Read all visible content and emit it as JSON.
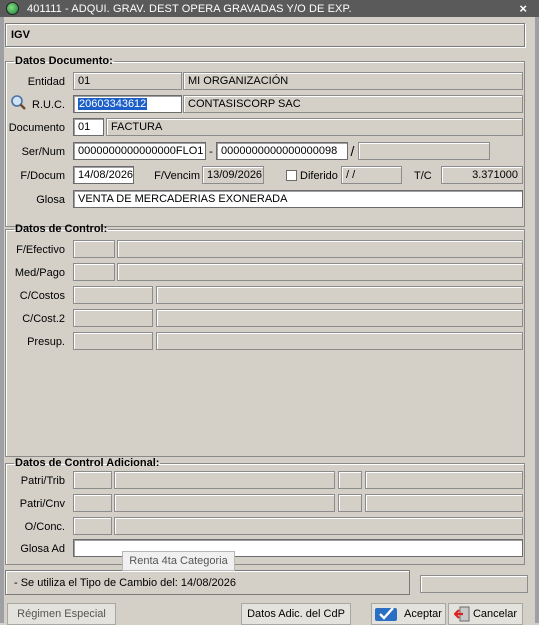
{
  "window": {
    "title": "401111 - ADQUI. GRAV. DEST OPERA GRAVADAS Y/O DE EXP.",
    "close_glyph": "×"
  },
  "header": {
    "label": "IGV"
  },
  "datos_documento": {
    "legend": "Datos Documento:",
    "entidad": {
      "label": "Entidad",
      "code": "01",
      "name": "MI ORGANIZACIÓN"
    },
    "ruc": {
      "label": "R.U.C.",
      "value": "20603343612",
      "name": "CONTASISCORP SAC"
    },
    "documento": {
      "label": "Documento",
      "code": "01",
      "name": "FACTURA"
    },
    "sernum": {
      "label": "Ser/Num",
      "serie": "0000000000000000FLO1",
      "sep": "-",
      "numero": "0000000000000000098",
      "slash": "/",
      "extra": ""
    },
    "fdocum": {
      "label": "F/Docum",
      "value": "14/08/2026"
    },
    "fvencim": {
      "label": "F/Vencim",
      "value": "13/09/2026"
    },
    "diferido": {
      "label": "Diferido",
      "value": " /  /",
      "checked": false
    },
    "tc": {
      "label": "T/C",
      "value": "3.371000"
    },
    "glosa": {
      "label": "Glosa",
      "value": "VENTA DE MERCADERIAS EXONERADA"
    }
  },
  "datos_control": {
    "legend": "Datos de Control:",
    "rows": [
      {
        "label": "F/Efectivo",
        "code": "",
        "desc": ""
      },
      {
        "label": "Med/Pago",
        "code": "",
        "desc": ""
      },
      {
        "label": "C/Costos",
        "code": "",
        "desc": ""
      },
      {
        "label": "C/Cost.2",
        "code": "",
        "desc": ""
      },
      {
        "label": "Presup.",
        "code": "",
        "desc": ""
      }
    ]
  },
  "datos_control_adicional": {
    "legend": "Datos de Control Adicional:",
    "patri_trib": {
      "label": "Patri/Trib"
    },
    "patri_cnv": {
      "label": "Patri/Cnv"
    },
    "o_conc": {
      "label": "O/Conc."
    },
    "glosa_ad": {
      "label": "Glosa Ad",
      "value": ""
    }
  },
  "tooltip": {
    "text": "Renta 4ta Categoria"
  },
  "status": {
    "text": "- Se utiliza el Tipo de Cambio del: 14/08/2026",
    "right": ""
  },
  "buttons": {
    "regimen": "Régimen Especial",
    "datos_adic": "Datos Adic. del CdP",
    "aceptar": "Aceptar",
    "cancelar": "Cancelar"
  },
  "icons": {
    "app": "app-logo-icon",
    "search": "magnifier-icon",
    "accept": "accept-icon",
    "cancel": "cancel-icon"
  }
}
